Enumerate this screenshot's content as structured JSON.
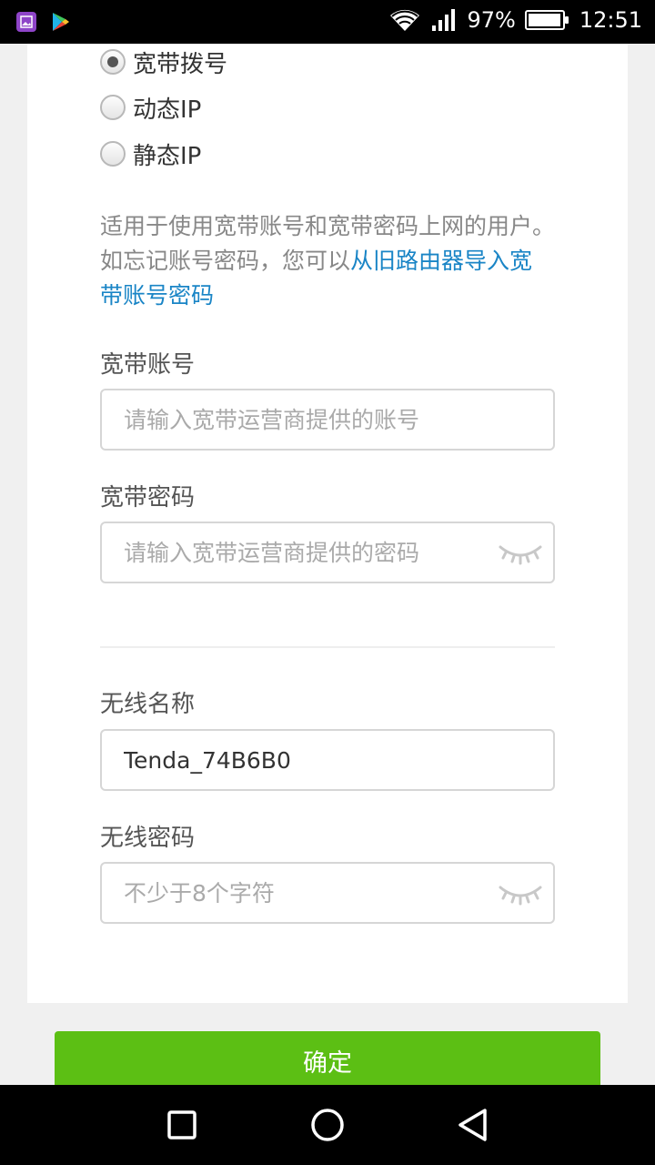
{
  "status_bar": {
    "battery_percent": "97%",
    "battery_level": 0.97,
    "time": "12:51",
    "icons": [
      "gallery-icon",
      "play-store-icon",
      "wifi-icon",
      "signal-icon",
      "battery-icon"
    ]
  },
  "connection_type": {
    "options": [
      {
        "label": "宽带拨号",
        "selected": true
      },
      {
        "label": "动态IP",
        "selected": false
      },
      {
        "label": "静态IP",
        "selected": false
      }
    ]
  },
  "description": {
    "text": "适用于使用宽带账号和宽带密码上网的用户。如忘记账号密码，您可以",
    "link": "从旧路由器导入宽带账号密码"
  },
  "pppoe": {
    "account_label": "宽带账号",
    "account_placeholder": "请输入宽带运营商提供的账号",
    "password_label": "宽带密码",
    "password_placeholder": "请输入宽带运营商提供的密码"
  },
  "wireless": {
    "ssid_label": "无线名称",
    "ssid_value": "Tenda_74B6B0",
    "password_label": "无线密码",
    "password_placeholder": "不少于8个字符"
  },
  "confirm_label": "确定",
  "colors": {
    "accent_green": "#5cbf14",
    "link_blue": "#1a85c6"
  }
}
